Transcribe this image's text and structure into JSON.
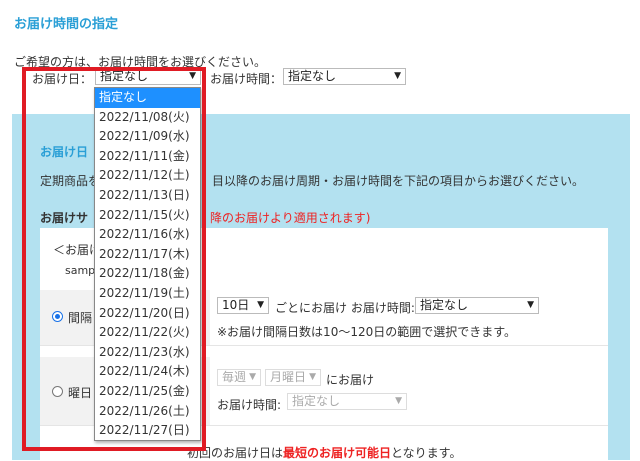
{
  "title": "お届け時間の指定",
  "intro": "ご希望の方は、お届け時間をお選びください。",
  "date_label": "お届け日：",
  "date_value": "指定なし",
  "time_label": "お届け時間：",
  "time_value": "指定なし",
  "date_options": [
    "指定なし",
    "2022/11/08(火)",
    "2022/11/09(水)",
    "2022/11/11(金)",
    "2022/11/12(土)",
    "2022/11/13(日)",
    "2022/11/15(火)",
    "2022/11/16(水)",
    "2022/11/17(木)",
    "2022/11/18(金)",
    "2022/11/19(土)",
    "2022/11/20(日)",
    "2022/11/22(火)",
    "2022/11/23(水)",
    "2022/11/24(木)",
    "2022/11/25(金)",
    "2022/11/26(土)",
    "2022/11/27(日)"
  ],
  "sub": {
    "heading": "お届け日",
    "desc_a": "定期商品を",
    "desc_b": "目以降のお届け周期・お届け時間を下記の項目からお選びください。",
    "cycle_heading": "お届けサ",
    "cycle_note": "降のお届けより適用されます)",
    "box_label": "＜お届け",
    "box_sample": "samp",
    "interval": {
      "label": "間隔",
      "days": "10日",
      "after": "ごとにお届け お届け時間:",
      "time": "指定なし",
      "note": "※お届け間隔日数は10～120日の範囲で選択できます。"
    },
    "weekday": {
      "label": "曜日",
      "freq": "毎週",
      "day": "月曜日",
      "after": "にお届け",
      "time_label": "お届け時間:",
      "time": "指定なし"
    },
    "footer_a": "初回のお届け日は",
    "footer_b": "最短のお届け可能日",
    "footer_c": "となります。"
  }
}
